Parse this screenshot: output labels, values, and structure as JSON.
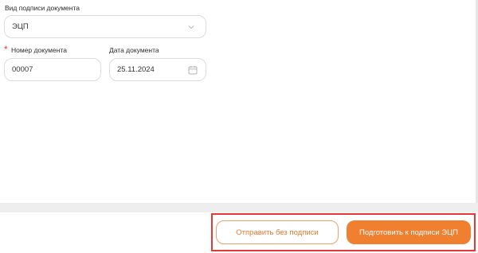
{
  "form": {
    "signature_type": {
      "label": "Вид подписи документа",
      "value": "ЭЦП"
    },
    "doc_number": {
      "label": "Номер документа",
      "required_mark": "*",
      "value": "00007"
    },
    "doc_date": {
      "label": "Дата документа",
      "value": "25.11.2024"
    }
  },
  "footer": {
    "send_without_signature_label": "Отправить без подписи",
    "prepare_for_signing_label": "Подготовить к подписи ЭЦП"
  },
  "colors": {
    "accent": "#f07f30",
    "highlight": "#e53935"
  },
  "icons": {
    "select_arrow": "chevron-down-icon",
    "date_picker": "calendar-icon"
  }
}
